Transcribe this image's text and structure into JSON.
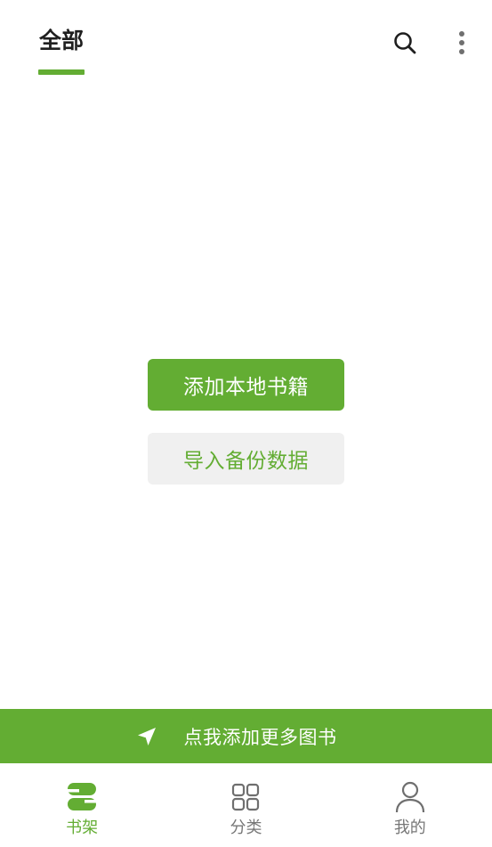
{
  "header": {
    "active_tab": "全部",
    "search_icon": "search-icon",
    "more_icon": "more-vertical-icon"
  },
  "actions": {
    "add_local_books": "添加本地书籍",
    "import_backup": "导入备份数据"
  },
  "promo": {
    "icon": "navigation-arrow-icon",
    "text": "点我添加更多图书"
  },
  "tabbar": {
    "items": [
      {
        "label": "书架",
        "icon": "bookshelf-icon",
        "active": true
      },
      {
        "label": "分类",
        "icon": "grid-icon",
        "active": false
      },
      {
        "label": "我的",
        "icon": "user-icon",
        "active": false
      }
    ]
  },
  "colors": {
    "accent": "#63ad33",
    "secondary_bg": "#f0f0f0",
    "inactive": "#777777"
  }
}
